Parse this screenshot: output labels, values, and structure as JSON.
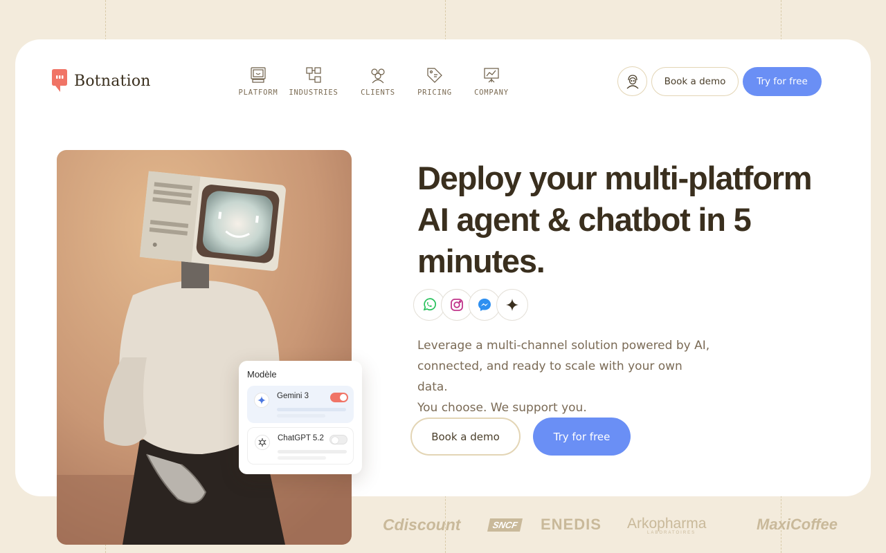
{
  "brand": {
    "name": "Botnation",
    "accent_color": "#f07466"
  },
  "nav": {
    "items": [
      {
        "label": "PLATFORM",
        "icon": "monitor-icon"
      },
      {
        "label": "INDUSTRIES",
        "icon": "blueprint-icon"
      },
      {
        "label": "CLIENTS",
        "icon": "people-icon"
      },
      {
        "label": "PRICING",
        "icon": "price-tag-icon"
      },
      {
        "label": "COMPANY",
        "icon": "presentation-board-icon"
      }
    ]
  },
  "header": {
    "account_icon": "user-avatar-icon",
    "book_demo": "Book a demo",
    "try_free": "Try for free",
    "primary_color": "#6a8ff5"
  },
  "hero": {
    "headline_line1": "Deploy your multi-platform",
    "headline_line2": "AI agent & chatbot in 5",
    "headline_line3": "minutes.",
    "channels": [
      "whatsapp-icon",
      "instagram-icon",
      "messenger-icon",
      "ai-sparkle-icon"
    ],
    "subtitle_line1": "Leverage a multi-channel solution powered by AI,",
    "subtitle_line2": "connected, and ready to scale with your own data.",
    "subtitle_line3": "You choose. We support you.",
    "book_demo": "Book a demo",
    "try_free": "Try for free"
  },
  "model_panel": {
    "title": "Modèle",
    "options": [
      {
        "name": "Gemini 3",
        "enabled": true,
        "icon": "gemini-icon"
      },
      {
        "name": "ChatGPT 5.2",
        "enabled": false,
        "icon": "openai-icon"
      }
    ]
  },
  "clients": {
    "logos": [
      "Cdiscount",
      "SNCF",
      "ENEDIS",
      "Arkopharma",
      "MaxiCoffee"
    ],
    "arkopharma_tagline": "LABORATOIRES"
  }
}
